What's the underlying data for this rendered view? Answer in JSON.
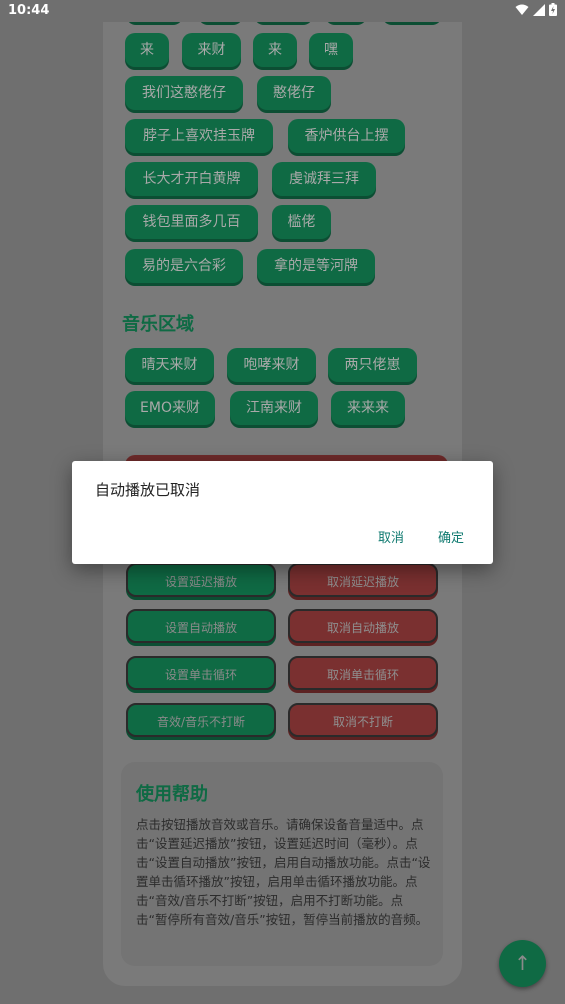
{
  "status_bar": {
    "time": "10:44"
  },
  "top_chips": [
    "来",
    "来财",
    "来",
    "嘿",
    "我们这憨佬仔",
    "憨佬仔",
    "脖子上喜欢挂玉牌",
    "香炉供台上摆",
    "长大才开白黄牌",
    "虔诚拜三拜",
    "钱包里面多几百",
    "槛佬",
    "易的是六合彩",
    "拿的是等河牌"
  ],
  "music": {
    "title": "音乐区域",
    "chips": [
      "晴天来财",
      "咆哮来财",
      "两只佬崽",
      "EMO来财",
      "江南来财",
      "来来来"
    ]
  },
  "controls": [
    {
      "green": "设置延迟播放",
      "red": "取消延迟播放"
    },
    {
      "green": "设置自动播放",
      "red": "取消自动播放"
    },
    {
      "green": "设置单击循环",
      "red": "取消单击循环"
    },
    {
      "green": "音效/音乐不打断",
      "red": "取消不打断"
    }
  ],
  "help": {
    "title": "使用帮助",
    "text": "点击按钮播放音效或音乐。请确保设备音量适中。点击“设置延迟播放”按钮，设置延迟时间（毫秒）。点击“设置自动播放”按钮，启用自动播放功能。点击“设置单击循环播放”按钮，启用单击循环播放功能。点击“音效/音乐不打断”按钮，启用不打断功能。点击“暂停所有音效/音乐”按钮，暂停当前播放的音频。"
  },
  "fab": {
    "label": "↑"
  },
  "dialog": {
    "message": "自动播放已取消",
    "cancel": "取消",
    "confirm": "确定"
  },
  "colors": {
    "accent_green": "#0f6a44",
    "accent_red": "#7a3030",
    "dialog_button": "#0f7a70"
  }
}
